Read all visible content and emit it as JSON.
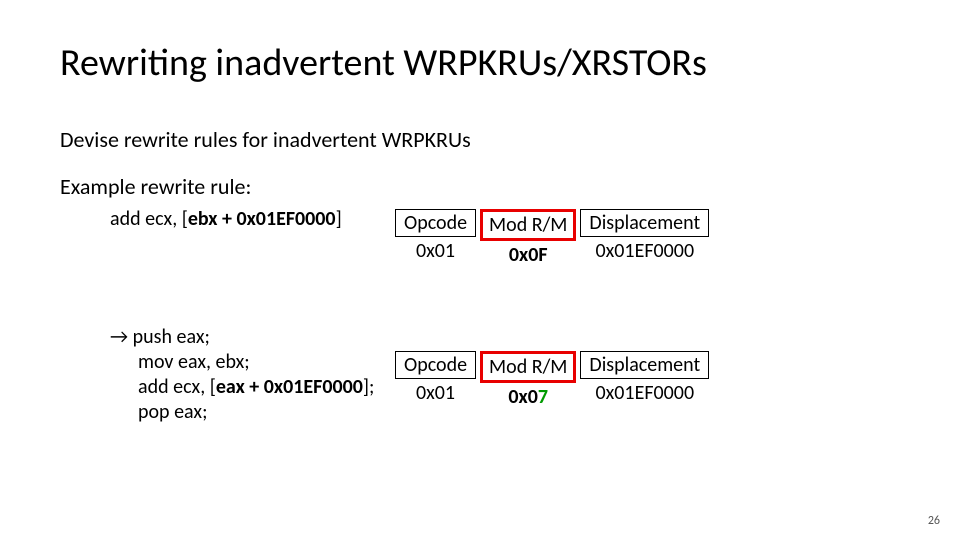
{
  "title": "Rewriting inadvertent WRPKRUs/XRSTORs",
  "intro1": "Devise rewrite rules for inadvertent WRPKRUs",
  "intro2": "Example rewrite rule:",
  "row1": {
    "code_prefix": "add ecx, [",
    "code_bold": "ebx + 0x01EF0000",
    "code_suffix": "]",
    "b1_label": "Opcode",
    "b1_val": "0x01",
    "b2_label": "Mod R/M",
    "b2_val": "0x0F",
    "b3_label": "Displacement",
    "b3_val": "0x01EF0000"
  },
  "row2": {
    "arrow": "→",
    "l1": " push eax;",
    "l2": "mov eax, ebx;",
    "l3_prefix": "add ecx, [",
    "l3_bold": "eax + 0x01EF0000",
    "l3_suffix": "];",
    "l4": "pop eax;",
    "b1_label": "Opcode",
    "b1_val": "0x01",
    "b2_label": "Mod R/M",
    "b2_val_pre": "0x0",
    "b2_val_green": "7",
    "b3_label": "Displacement",
    "b3_val": "0x01EF0000"
  },
  "page": "26"
}
